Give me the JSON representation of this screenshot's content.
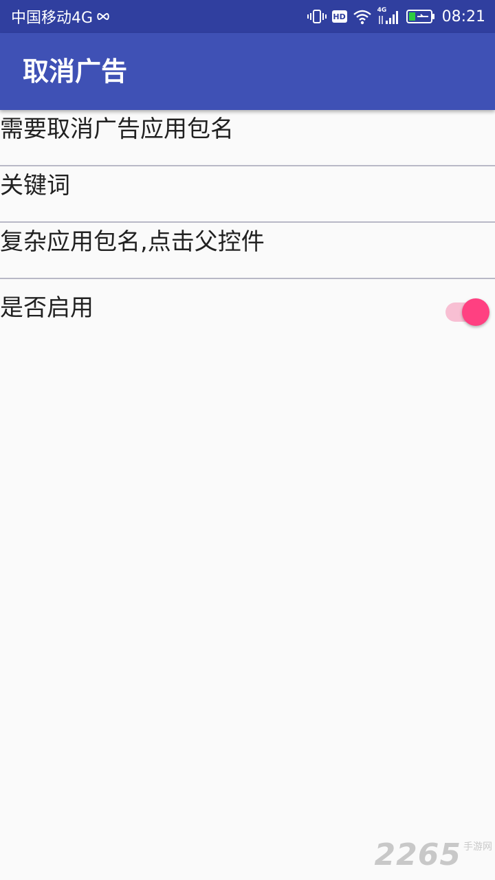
{
  "status_bar": {
    "carrier": "中国移动4G",
    "network_type": "4G",
    "hd_badge": "HD",
    "time": "08:21",
    "icons": [
      "infinity-icon",
      "vibrate-icon",
      "hd-icon",
      "wifi-icon",
      "signal-icon",
      "battery-charging-icon"
    ]
  },
  "app_bar": {
    "title": "取消广告",
    "color": "#3f51b5",
    "status_color": "#303f9f"
  },
  "fields": [
    {
      "placeholder": "需要取消广告应用包名",
      "value": ""
    },
    {
      "placeholder": "关键词",
      "value": ""
    },
    {
      "placeholder": "复杂应用包名,点击父控件",
      "value": ""
    }
  ],
  "enable_switch": {
    "label": "是否启用",
    "checked": true,
    "accent_color": "#ff4081"
  },
  "watermark": {
    "number": "2265",
    "text": "手游网"
  }
}
